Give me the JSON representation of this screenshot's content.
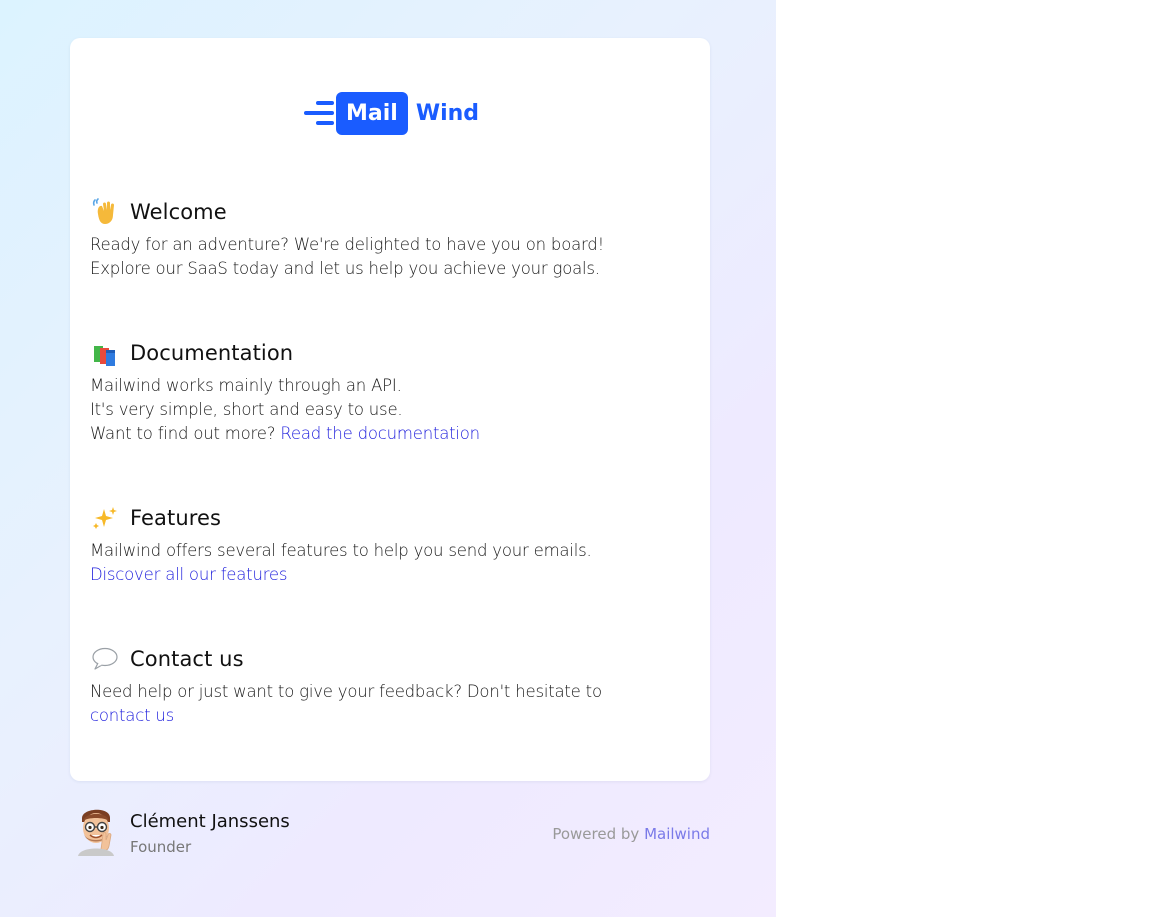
{
  "logo": {
    "box_text": "Mail",
    "word_text": "Wind",
    "brand_color": "#1a5cff"
  },
  "sections": [
    {
      "icon": "waving-hand-icon",
      "title": "Welcome",
      "lines": [
        "Ready for an adventure? We're delighted to have you on board!",
        "Explore our SaaS today and let us help you achieve your goals."
      ]
    },
    {
      "icon": "books-icon",
      "title": "Documentation",
      "lines": [
        "Mailwind works mainly through an API.",
        "It's very simple, short and easy to use."
      ],
      "prompt": "Want to find out more? ",
      "link": "Read the documentation"
    },
    {
      "icon": "sparkles-icon",
      "title": "Features",
      "lines": [
        "Mailwind offers several features to help you send your emails."
      ],
      "link": "Discover all our features"
    },
    {
      "icon": "speech-bubble-icon",
      "title": "Contact us",
      "lines": [
        "Need help or just want to give your feedback? Don't hesitate to"
      ],
      "link": "contact us"
    }
  ],
  "footer": {
    "sender_name": "Clément Janssens",
    "sender_role": "Founder",
    "powered_prefix": "Powered by ",
    "powered_link": "Mailwind"
  },
  "colors": {
    "link": "#2222dd",
    "powered_link": "#7a7ae8"
  }
}
